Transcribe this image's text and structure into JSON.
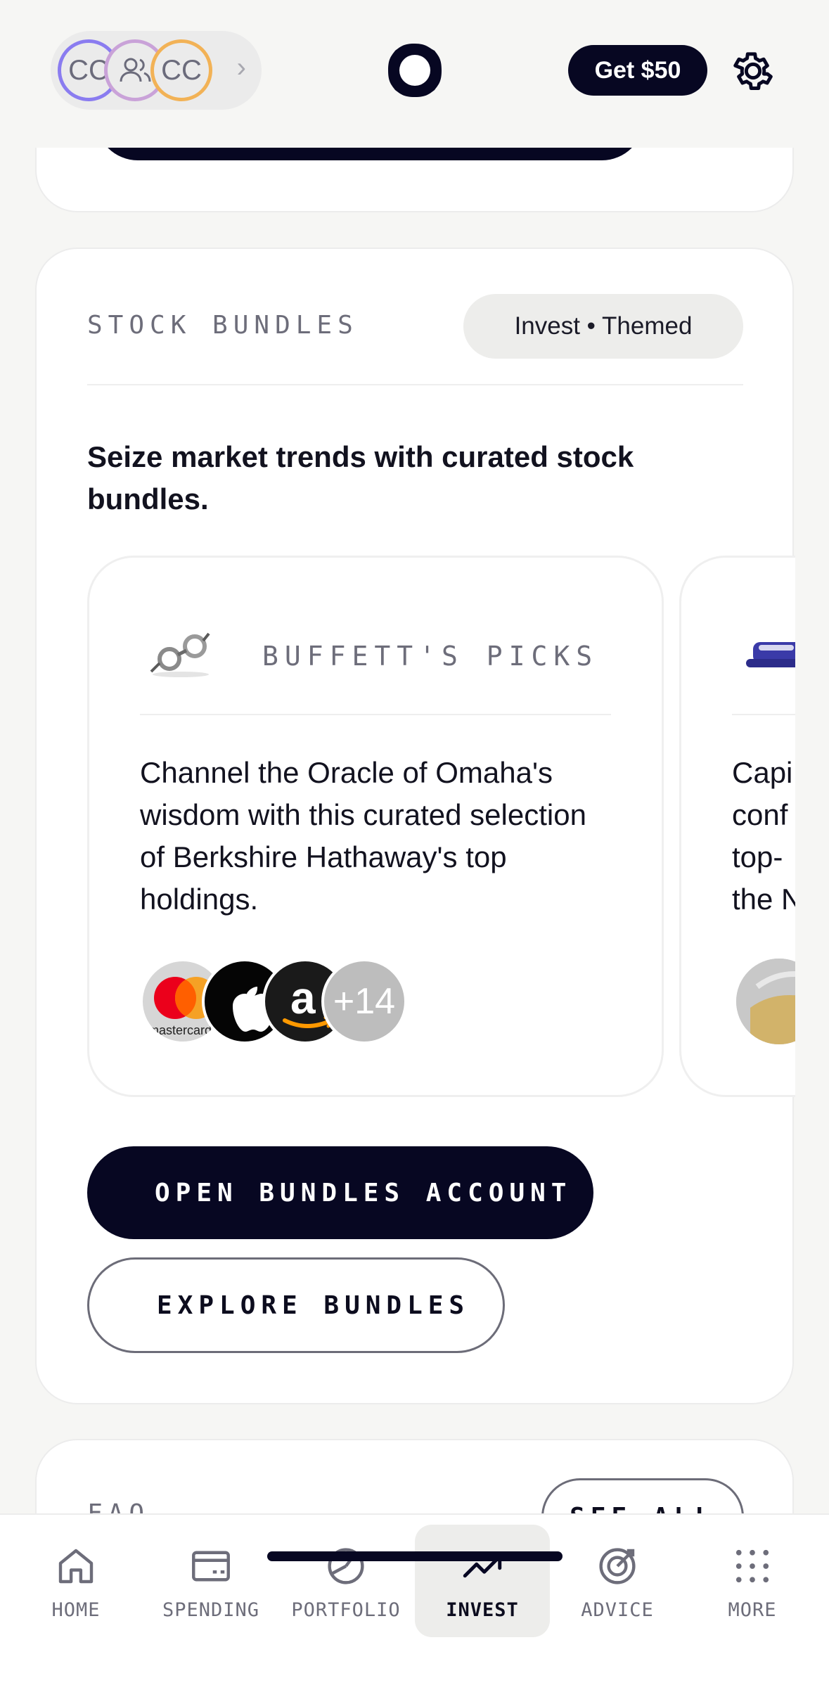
{
  "header": {
    "account_initials_1": "CC",
    "account_initials_3": "CC",
    "account_chevron": "›",
    "get_money_label": "Get $50"
  },
  "stock_bundles": {
    "section_label": "STOCK BUNDLES",
    "tag_label": "Invest • Themed",
    "lead_text": "Seize market trends with curated stock bundles.",
    "bundles": [
      {
        "title": "BUFFETT'S PICKS",
        "icon": "eyeglasses-icon",
        "description": "Channel the Oracle of Omaha's wisdom with this curated selection of Berkshire Hathaway's top holdings.",
        "holdings_logos": [
          "mastercard-logo",
          "apple-logo",
          "amazon-logo"
        ],
        "more_count": "+14"
      },
      {
        "icon": "stapler-icon",
        "description_partial": "Capi\nconf\ntop-\nthe N"
      }
    ],
    "open_account_label": "OPEN BUNDLES ACCOUNT",
    "explore_label": "EXPLORE BUNDLES"
  },
  "faq": {
    "label": "FAQ",
    "see_all_label": "SEE ALL"
  },
  "tabbar": {
    "tabs": [
      {
        "label": "HOME",
        "icon": "home-icon"
      },
      {
        "label": "SPENDING",
        "icon": "card-icon"
      },
      {
        "label": "PORTFOLIO",
        "icon": "pie-chart-icon"
      },
      {
        "label": "INVEST",
        "icon": "trending-up-icon",
        "active": true
      },
      {
        "label": "ADVICE",
        "icon": "target-icon"
      },
      {
        "label": "MORE",
        "icon": "grid-dots-icon"
      }
    ]
  },
  "colors": {
    "brand_dark": "#070722",
    "background": "#f6f6f4",
    "accent_purple": "#8a7cf0",
    "accent_orange": "#f2b256"
  }
}
